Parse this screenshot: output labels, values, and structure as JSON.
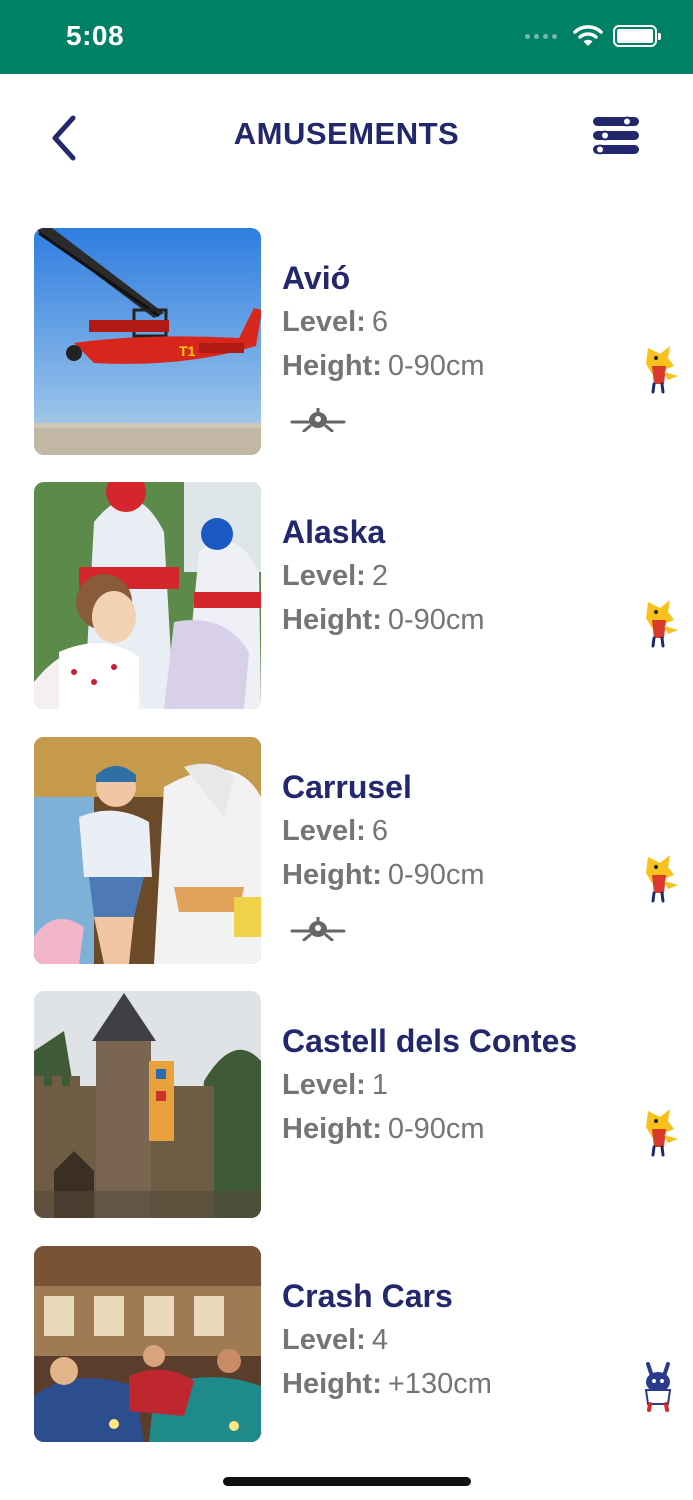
{
  "status": {
    "time": "5:08"
  },
  "header": {
    "title": "AMUSEMENTS"
  },
  "labels": {
    "level": "Level:",
    "height": "Height:"
  },
  "rides": [
    {
      "name": " Avió",
      "level": "6",
      "height": "0-90cm",
      "plane_icon": true,
      "mascot": "yellow-mascot-icon"
    },
    {
      "name": "Alaska",
      "level": "2",
      "height": "0-90cm",
      "plane_icon": false,
      "mascot": "yellow-mascot-icon"
    },
    {
      "name": "Carrusel",
      "level": "6",
      "height": "0-90cm",
      "plane_icon": true,
      "mascot": "yellow-mascot-icon"
    },
    {
      "name": "Castell dels Contes",
      "level": "1",
      "height": "0-90cm",
      "plane_icon": false,
      "mascot": "yellow-mascot-icon"
    },
    {
      "name": "Crash Cars",
      "level": "4",
      "height": "+130cm",
      "plane_icon": false,
      "mascot": "blue-mascot-icon"
    }
  ],
  "colors": {
    "status_bar": "#008166",
    "title": "#23276b",
    "text_gray": "#757575"
  }
}
